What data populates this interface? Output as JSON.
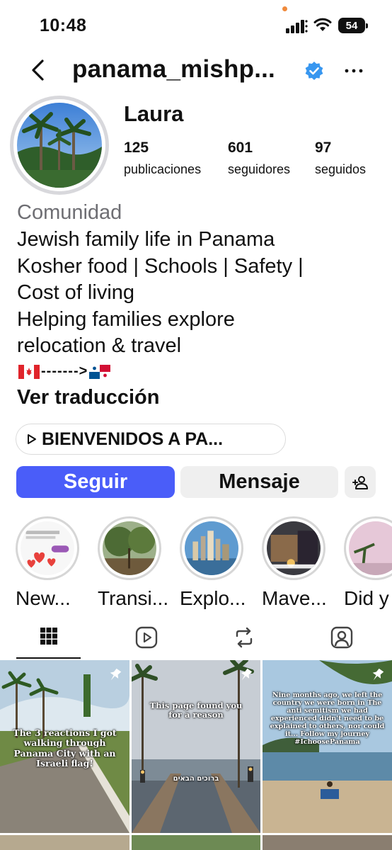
{
  "status_bar": {
    "time": "10:48",
    "battery": "54"
  },
  "header": {
    "username": "panama_mishp...",
    "verified": true
  },
  "profile": {
    "name": "Laura",
    "stats": [
      {
        "value": "125",
        "label": "publicaciones"
      },
      {
        "value": "601",
        "label": "seguidores"
      },
      {
        "value": "97",
        "label": "seguidos"
      }
    ],
    "category": "Comunidad",
    "bio_lines": [
      "Jewish family life in Panama",
      "Kosher food | Schools | Safety |",
      "Cost of living",
      "Helping families explore",
      "relocation & travel"
    ],
    "flags_arrow": "------->",
    "translate_label": "Ver traducción",
    "link_label": "BIENVENIDOS A PA..."
  },
  "actions": {
    "follow_label": "Seguir",
    "message_label": "Mensaje"
  },
  "highlights": [
    {
      "label": "New..."
    },
    {
      "label": "Transi..."
    },
    {
      "label": "Explo..."
    },
    {
      "label": "Mave..."
    },
    {
      "label": "Did y"
    }
  ],
  "tabs": [
    {
      "name": "grid-icon",
      "active": true
    },
    {
      "name": "reels-icon",
      "active": false
    },
    {
      "name": "reposts-icon",
      "active": false
    },
    {
      "name": "tagged-icon",
      "active": false
    }
  ],
  "posts": [
    {
      "text": "The 3 reactions I got walking through Panama City with an Israeli flag!",
      "pinned": true
    },
    {
      "text": "This page found you for a reason",
      "subtext": "ברוכים הבאים",
      "pinned": true
    },
    {
      "text": "Nine months ago, we left the country we were born in The anti semitism we had experienced didn't need to be explained to others, nor could it... Follow my journey #IchoosePanama",
      "pinned": true
    }
  ],
  "colors": {
    "accent": "#4a5df9",
    "verified": "#3897f0",
    "muted": "#6e6e73"
  }
}
